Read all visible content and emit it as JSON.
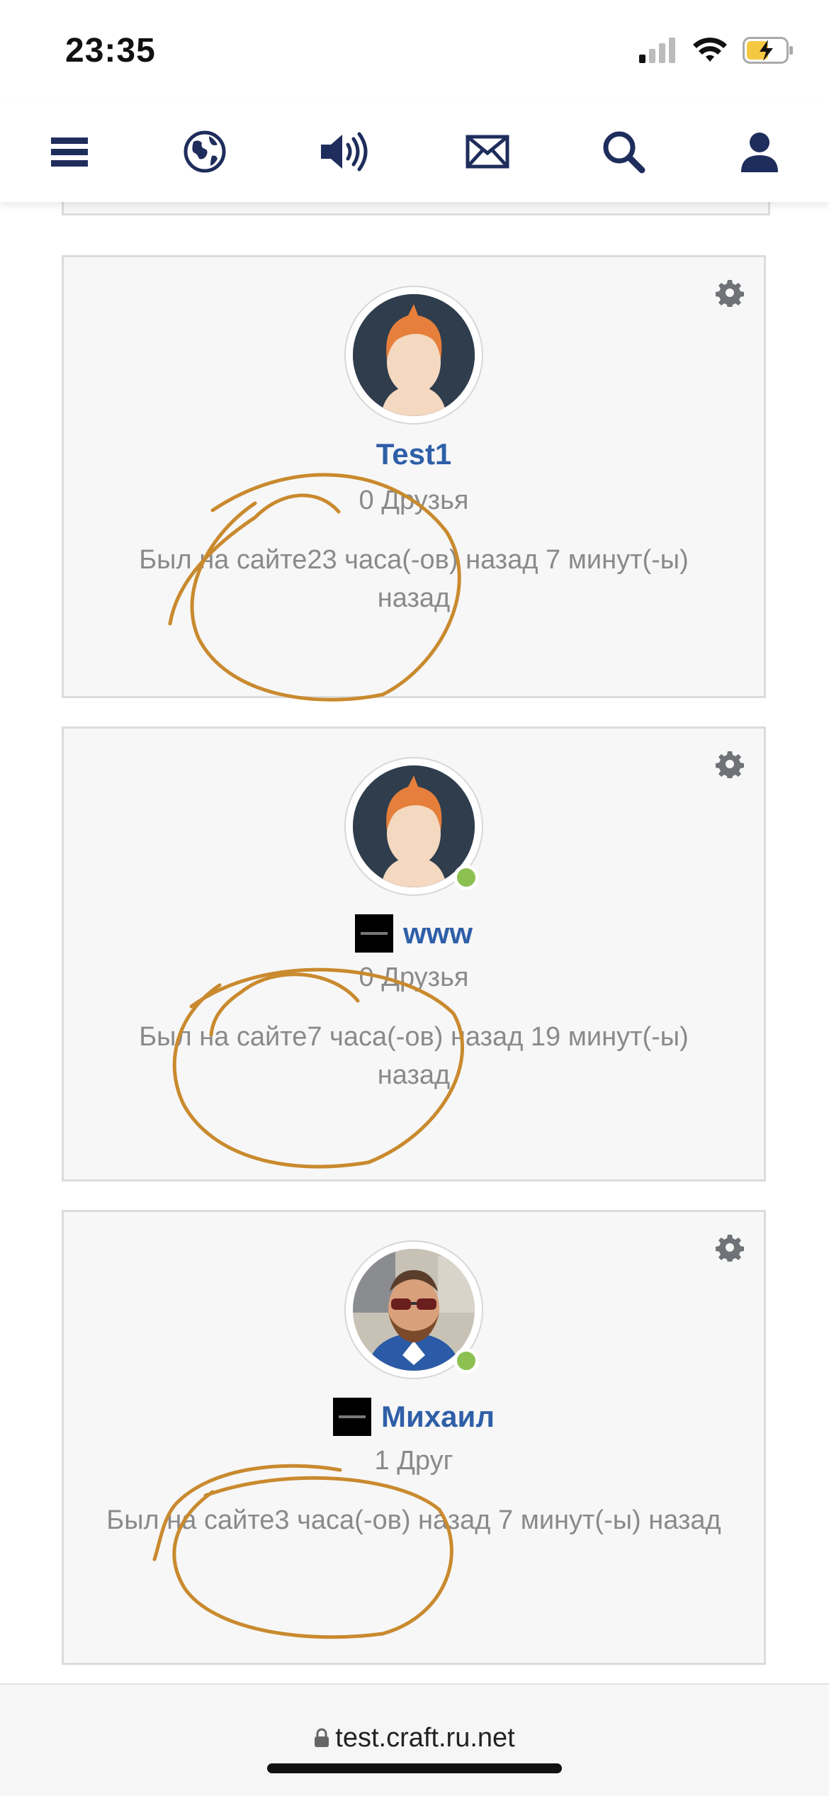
{
  "status_bar": {
    "time": "23:35"
  },
  "nav": {
    "items": [
      {
        "icon": "menu-icon"
      },
      {
        "icon": "globe-icon"
      },
      {
        "icon": "speaker-icon"
      },
      {
        "icon": "mail-icon"
      },
      {
        "icon": "search-icon"
      },
      {
        "icon": "user-icon"
      }
    ],
    "icon_color": "#1f2d5c"
  },
  "users": [
    {
      "name": "Test1",
      "friends": "0 Друзья",
      "last_seen": "Был на сайте23 часа(-ов) назад 7 минут(-ы) назад",
      "online": false,
      "has_badge": false
    },
    {
      "name": "www",
      "friends": "0 Друзья",
      "last_seen": "Был на сайте7 часа(-ов) назад 19 минут(-ы) назад",
      "online": true,
      "has_badge": true
    },
    {
      "name": "Михаил",
      "friends": "1 Друг",
      "last_seen": "Был на сайте3 часа(-ов) назад 7 минут(-ы) назад",
      "online": true,
      "has_badge": true
    }
  ],
  "address_bar": {
    "url": "test.craft.ru.net"
  },
  "colors": {
    "name_link": "#2f5fa8",
    "online": "#8cc152",
    "annotation": "#c98a2e"
  }
}
